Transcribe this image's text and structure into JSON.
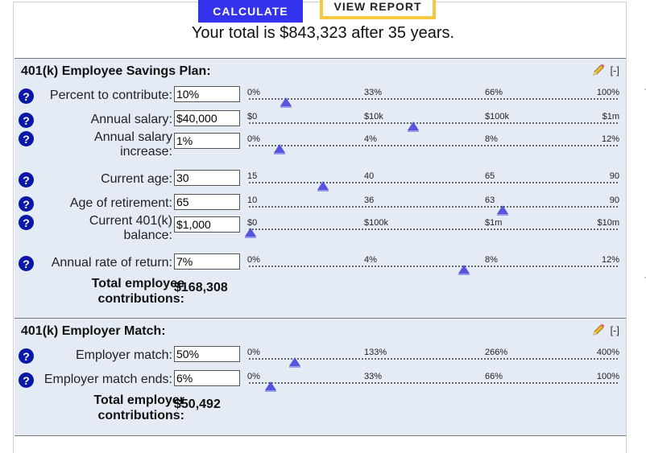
{
  "header": {
    "calculate_label": "CALCULATE",
    "view_report_label": "VIEW REPORT",
    "total_text": "Your total is $843,323 after 35 years."
  },
  "employee_plan": {
    "title": "401(k) Employee Savings Plan:",
    "collapse_label": "[-]",
    "fields": [
      {
        "label": "Percent to contribute:",
        "value": "10%",
        "ticks": [
          "0%",
          "33%",
          "66%",
          "100%"
        ],
        "position": 0.1
      },
      {
        "label": "Annual salary:",
        "value": "$40,000",
        "ticks": [
          "$0",
          "$10k",
          "$100k",
          "$1m"
        ],
        "position": 0.445
      },
      {
        "label": "Annual salary increase:",
        "value": "1%",
        "ticks": [
          "0%",
          "4%",
          "8%",
          "12%"
        ],
        "position": 0.083
      },
      {
        "label": "Current age:",
        "value": "30",
        "ticks": [
          "15",
          "40",
          "65",
          "90"
        ],
        "position": 0.2
      },
      {
        "label": "Age of retirement:",
        "value": "65",
        "ticks": [
          "10",
          "36",
          "63",
          "90"
        ],
        "position": 0.6875
      },
      {
        "label": "Current 401(k) balance:",
        "value": "$1,000",
        "ticks": [
          "$0",
          "$100k",
          "$1m",
          "$10m"
        ],
        "position": 0.005
      },
      {
        "label": "Annual rate of return:",
        "value": "7%",
        "ticks": [
          "0%",
          "4%",
          "8%",
          "12%"
        ],
        "position": 0.583
      }
    ],
    "total_label": "Total employee contributions:",
    "total_value": "$168,308"
  },
  "employer_match": {
    "title": "401(k) Employer Match:",
    "collapse_label": "[-]",
    "fields": [
      {
        "label": "Employer match:",
        "value": "50%",
        "ticks": [
          "0%",
          "133%",
          "266%",
          "400%"
        ],
        "position": 0.125
      },
      {
        "label": "Employer match ends:",
        "value": "6%",
        "ticks": [
          "0%",
          "33%",
          "66%",
          "100%"
        ],
        "position": 0.06
      }
    ],
    "total_label": "Total employer contributions:",
    "total_value": "$50,492"
  },
  "help_icon_text": "?",
  "colors": {
    "calculate_bg": "#3333ee",
    "report_border": "#f5c842",
    "section_bg": "#e4ebf4",
    "help_bg": "#0a18a8",
    "thumb": "#5555dd"
  }
}
